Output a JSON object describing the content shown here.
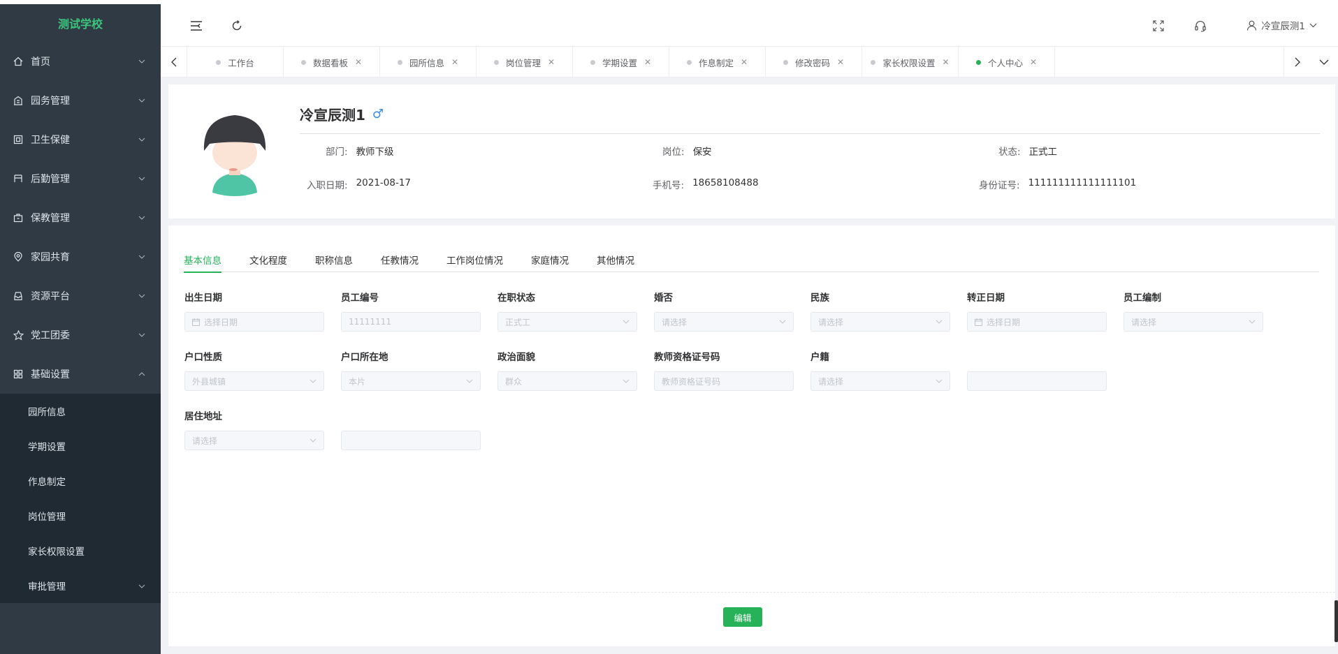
{
  "colors": {
    "accent": "#27b25a",
    "sidebar_bg": "#2f3a44",
    "submenu_bg": "#1f2a33",
    "brand": "#3cc47c"
  },
  "sidebar": {
    "brand": "测试学校",
    "items": [
      {
        "label": "首页",
        "icon": "home-icon"
      },
      {
        "label": "园务管理",
        "icon": "building-icon"
      },
      {
        "label": "卫生保健",
        "icon": "health-icon"
      },
      {
        "label": "后勤管理",
        "icon": "logistics-icon"
      },
      {
        "label": "保教管理",
        "icon": "bag-icon"
      },
      {
        "label": "家园共育",
        "icon": "location-icon"
      },
      {
        "label": "资源平台",
        "icon": "inbox-icon"
      },
      {
        "label": "党工团委",
        "icon": "star-icon"
      },
      {
        "label": "基础设置",
        "icon": "grid-icon",
        "expanded": true
      }
    ],
    "subitems": [
      {
        "label": "园所信息"
      },
      {
        "label": "学期设置"
      },
      {
        "label": "作息制定"
      },
      {
        "label": "岗位管理"
      },
      {
        "label": "家长权限设置"
      },
      {
        "label": "审批管理"
      }
    ]
  },
  "header": {
    "user_name": "冷宣辰测1"
  },
  "tabs": [
    {
      "label": "工作台",
      "closable": false
    },
    {
      "label": "数据看板",
      "closable": true
    },
    {
      "label": "园所信息",
      "closable": true
    },
    {
      "label": "岗位管理",
      "closable": true
    },
    {
      "label": "学期设置",
      "closable": true
    },
    {
      "label": "作息制定",
      "closable": true
    },
    {
      "label": "修改密码",
      "closable": true
    },
    {
      "label": "家长权限设置",
      "closable": true
    },
    {
      "label": "个人中心",
      "closable": true,
      "active": true
    }
  ],
  "profile": {
    "name": "冷宣辰测1",
    "gender_symbol": "♂",
    "dept_label": "部门:",
    "dept": "教师下级",
    "post_label": "岗位:",
    "post": "保安",
    "status_label": "状态:",
    "status": "正式工",
    "join_label": "入职日期:",
    "join_date": "2021-08-17",
    "phone_label": "手机号:",
    "phone": "18658108488",
    "id_label": "身份证号:",
    "id_no": "111111111111111101"
  },
  "detail_tabs": [
    "基本信息",
    "文化程度",
    "职称信息",
    "任教情况",
    "工作岗位情况",
    "家庭情况",
    "其他情况"
  ],
  "form": {
    "birth": {
      "label": "出生日期",
      "value": "选择日期"
    },
    "empno": {
      "label": "员工编号",
      "value": "11111111"
    },
    "jobstatus": {
      "label": "在职状态",
      "value": "正式工"
    },
    "marriage": {
      "label": "婚否",
      "value": "请选择"
    },
    "nation": {
      "label": "民族",
      "value": "请选择"
    },
    "regular": {
      "label": "转正日期",
      "value": "选择日期"
    },
    "staffing": {
      "label": "员工编制",
      "value": "请选择"
    },
    "hukou_type": {
      "label": "户口性质",
      "value": "外县城镇"
    },
    "hukou_place": {
      "label": "户口所在地",
      "value": "本片"
    },
    "politics": {
      "label": "政治面貌",
      "value": "群众"
    },
    "cert": {
      "label": "教师资格证号码",
      "value": "教师资格证号码"
    },
    "huji": {
      "label": "户籍",
      "value": "请选择"
    },
    "extra": {
      "value": ""
    },
    "address": {
      "label": "居住地址",
      "value": "请选择"
    },
    "address_detail": {
      "value": ""
    }
  },
  "edit_button": "编辑"
}
